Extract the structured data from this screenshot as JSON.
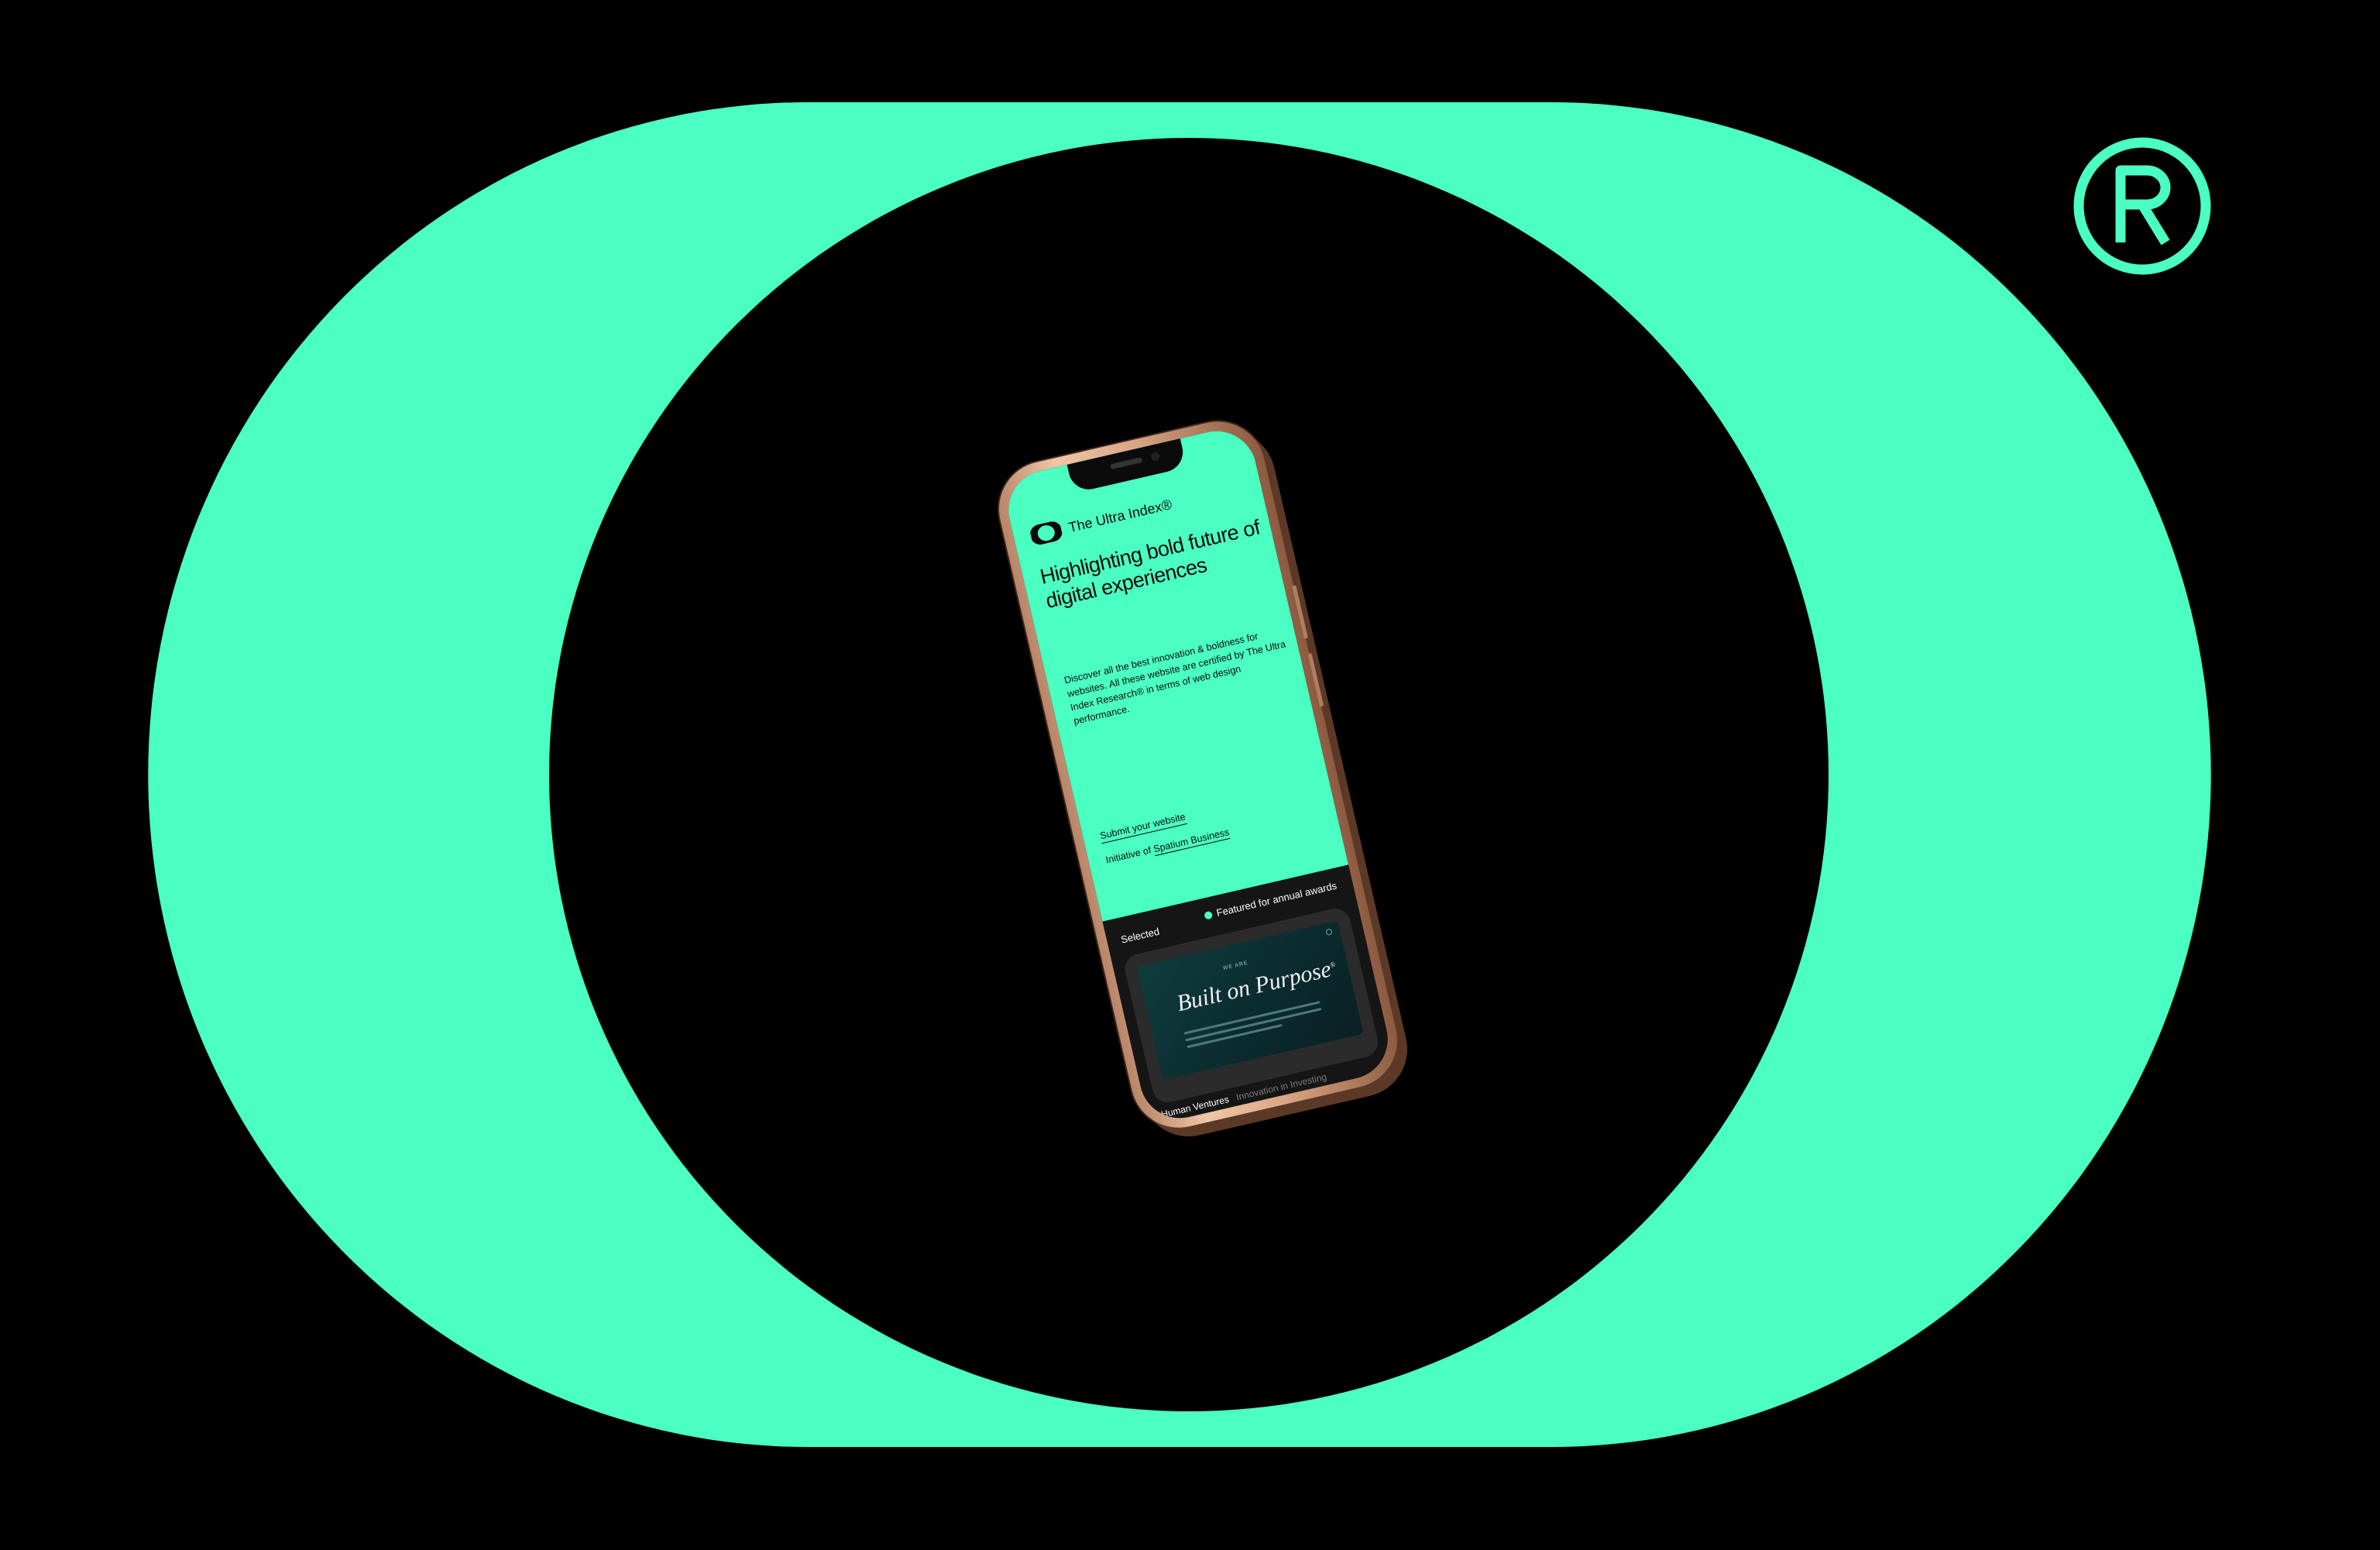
{
  "colors": {
    "background": "#000000",
    "accent": "#4affc1",
    "phone_frame": "#d9a584"
  },
  "backdrop": {
    "logo_icon": "ultra-index-o-logo",
    "registered_mark": "®"
  },
  "phone": {
    "brand": {
      "icon": "ultra-index-o-logo-small",
      "name": "The Ultra Index®"
    },
    "headline": "Highlighting bold future of digital experiences",
    "description": "Discover all the best innovation & boldness for websites. All these website are certified by The Ultra Index Research® in terms of web design performance.",
    "submit_link": "Submit your website",
    "initiative_prefix": "Initiative of ",
    "initiative_link": "Spatium Business",
    "selected_label": "Selected",
    "featured_label": "Featured for annual awards",
    "card": {
      "preview_kicker": "WE ARE",
      "preview_title": "Built on Purpose",
      "preview_title_mark": "®"
    },
    "bottom": {
      "name": "Human Ventures",
      "tag": "Innovation in Investing"
    }
  }
}
